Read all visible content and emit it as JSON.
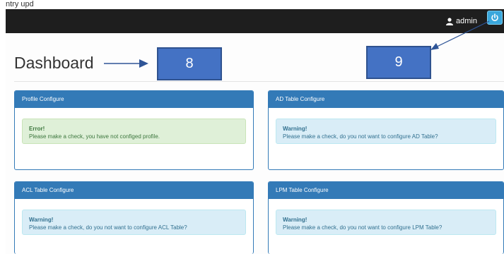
{
  "caption": "ntry upd",
  "header": {
    "username": "admin"
  },
  "page_title": "Dashboard",
  "annotations": {
    "label_8": "8",
    "label_9": "9"
  },
  "panels": [
    {
      "heading": "Profile Configure",
      "alert_type": "success",
      "alert_title": "Error!",
      "alert_message": "Please make a check, you have not configed profile."
    },
    {
      "heading": "AD Table Configure",
      "alert_type": "info",
      "alert_title": "Warning!",
      "alert_message": "Please make a check, do you not want to configure AD Table?"
    },
    {
      "heading": "ACL Table Configure",
      "alert_type": "info",
      "alert_title": "Warning!",
      "alert_message": "Please make a check, do you not want to configure ACL Table?"
    },
    {
      "heading": "LPM Table Configure",
      "alert_type": "info",
      "alert_title": "Warning!",
      "alert_message": "Please make a check, do you not want to configure LPM Table?"
    }
  ],
  "icons": {
    "user": "user-icon",
    "logout": "power-icon"
  },
  "colors": {
    "navbar": "#1e1e1e",
    "panel_primary": "#337ab7",
    "logout_button": "#3aa7dc",
    "annotation": "#4472c4",
    "alert_success_bg": "#dff0d8",
    "alert_info_bg": "#d9edf7"
  }
}
